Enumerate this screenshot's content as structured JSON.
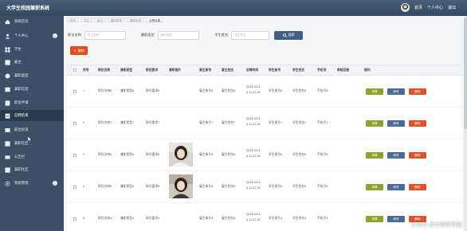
{
  "header": {
    "title": "大学生校园兼职系统",
    "home_label": "首页",
    "profile_label": "个人中心",
    "logout_label": "退出"
  },
  "sidebar": {
    "items": [
      {
        "label": "系统首页",
        "icon": "home-icon"
      },
      {
        "label": "个人中心",
        "icon": "user-icon",
        "expandable": true
      },
      {
        "label": "学生",
        "icon": "grid-icon"
      },
      {
        "label": "雇主",
        "icon": "grid-icon"
      },
      {
        "label": "兼职类型",
        "icon": "grid-icon"
      },
      {
        "label": "兼职信息",
        "icon": "grid-icon"
      },
      {
        "label": "职位申请",
        "icon": "grid-icon"
      },
      {
        "label": "应聘结果",
        "icon": "grid-icon"
      },
      {
        "label": "职位投诉",
        "icon": "grid-icon"
      },
      {
        "label": "兼职社区",
        "icon": "grid-icon"
      },
      {
        "label": "公告栏",
        "icon": "grid-icon"
      },
      {
        "label": "兼职社区",
        "icon": "grid-icon"
      },
      {
        "label": "系统管理",
        "icon": "gear-icon",
        "expandable": true
      }
    ],
    "active_index": 7
  },
  "breadcrumb": [
    "首页",
    "学生",
    "雇主",
    "兼职类型",
    "兼职信息",
    "应聘结果"
  ],
  "search": {
    "job_name_label": "职位名称",
    "job_name_placeholder": "职位名称",
    "job_type_label": "兼职类型",
    "job_type_placeholder": "兼职类型",
    "student_name_label": "学生姓名",
    "student_name_placeholder": "学生姓名",
    "search_button": "搜索"
  },
  "toolbar": {
    "delete_label": "删除"
  },
  "table": {
    "columns": [
      "序号",
      "职位名称",
      "兼职类型",
      "职位要求",
      "兼职图片",
      "雇主账号",
      "雇主姓名",
      "应聘时间",
      "学生账号",
      "学生姓名",
      "手机号",
      "审核回复",
      "操作"
    ],
    "rows": [
      {
        "index": "1",
        "job_name": "职位名称8",
        "job_type": "兼职类型8",
        "requirement": "职位要求8",
        "image": "",
        "employer_account": "雇主账号8",
        "employer_name": "雇主姓名8",
        "time_line1": "2024-03-2",
        "time_line2": "6 11:47:30",
        "student_account": "学生账号8",
        "student_name": "学生姓名8",
        "phone": "手机号8",
        "reply": ""
      },
      {
        "index": "2",
        "job_name": "职位名称7",
        "job_type": "兼职类型7",
        "requirement": "职位要求7",
        "image": "",
        "employer_account": "雇主账号7",
        "employer_name": "雇主姓名7",
        "time_line1": "2024-03-2",
        "time_line2": "6 11:47:30",
        "student_account": "学生账号7",
        "student_name": "学生姓名7",
        "phone": "手机号7",
        "reply": ""
      },
      {
        "index": "3",
        "job_name": "职位名称6",
        "job_type": "兼职类型6",
        "requirement": "职位要求6",
        "image": "photo",
        "employer_account": "雇主账号6",
        "employer_name": "雇主姓名6",
        "time_line1": "2024-03-2",
        "time_line2": "6 11:47:30",
        "student_account": "学生账号6",
        "student_name": "学生姓名6",
        "phone": "手机号6",
        "reply": ""
      },
      {
        "index": "4",
        "job_name": "职位名称5",
        "job_type": "兼职类型5",
        "requirement": "职位要求5",
        "image": "photo",
        "employer_account": "雇主账号5",
        "employer_name": "雇主姓名5",
        "time_line1": "2024-03-2",
        "time_line2": "6 11:47:30",
        "student_account": "学生账号5",
        "student_name": "学生姓名5",
        "phone": "手机号5",
        "reply": ""
      },
      {
        "index": "5",
        "job_name": "职位名称4",
        "job_type": "兼职类型4",
        "requirement": "职位要求4",
        "image": "",
        "employer_account": "雇主账号4",
        "employer_name": "雇主姓名4",
        "time_line1": "2024-03-2",
        "time_line2": "6 11:47:30",
        "student_account": "学生账号4",
        "student_name": "学生姓名4",
        "phone": "手机号4",
        "reply": ""
      }
    ],
    "actions": {
      "detail": "详情",
      "edit": "修改",
      "delete": "删除"
    }
  },
  "watermark": "CSDN @计算机科技"
}
